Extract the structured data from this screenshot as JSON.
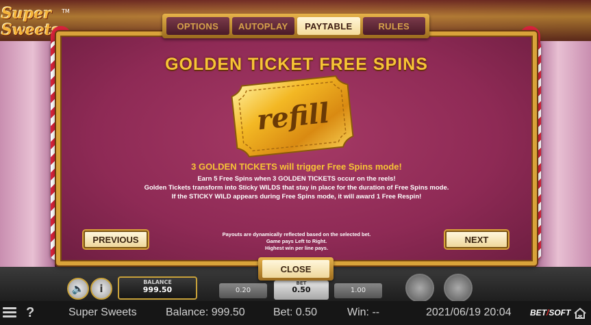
{
  "game": {
    "logo_line1": "Super",
    "logo_line2": "Sweets",
    "logo_tm": "TM"
  },
  "tabs": [
    {
      "label": "OPTIONS",
      "active": false
    },
    {
      "label": "AUTOPLAY",
      "active": false
    },
    {
      "label": "PAYTABLE",
      "active": true
    },
    {
      "label": "RULES",
      "active": false
    }
  ],
  "paytable": {
    "title": "GOLDEN TICKET FREE SPINS",
    "ticket_text": "refill",
    "headline": "3 GOLDEN TICKETS will trigger Free Spins mode!",
    "lines": [
      "Earn 5 Free Spins when 3 GOLDEN TICKETS occur on the reels!",
      "Golden Tickets transform into Sticky WILDS that stay in place for the duration of Free Spins mode.",
      "If the STICKY WILD appears during Free Spins mode, it will award 1 Free Respin!"
    ],
    "footnotes": [
      "Payouts are dynamically reflected based on the selected bet.",
      "Game pays Left to Right.",
      "Highest win per line pays."
    ],
    "previous_label": "PREVIOUS",
    "next_label": "NEXT",
    "close_label": "CLOSE"
  },
  "machine": {
    "balance_label": "BALANCE",
    "balance_value": "999.50",
    "bet_options": [
      "0.20",
      "1.00"
    ],
    "bet_label": "BET",
    "bet_value": "0.50"
  },
  "statusbar": {
    "game_name": "Super Sweets",
    "balance": "Balance: 999.50",
    "bet": "Bet: 0.50",
    "win": "Win: --",
    "datetime": "2021/06/19 20:04",
    "brand_a": "BET",
    "brand_b": "SOFT"
  },
  "colors": {
    "panel": "#8e2a55",
    "gold": "#f7c436",
    "frame": "#d9a33a",
    "tab_active_bg": "#f4dc9a"
  }
}
